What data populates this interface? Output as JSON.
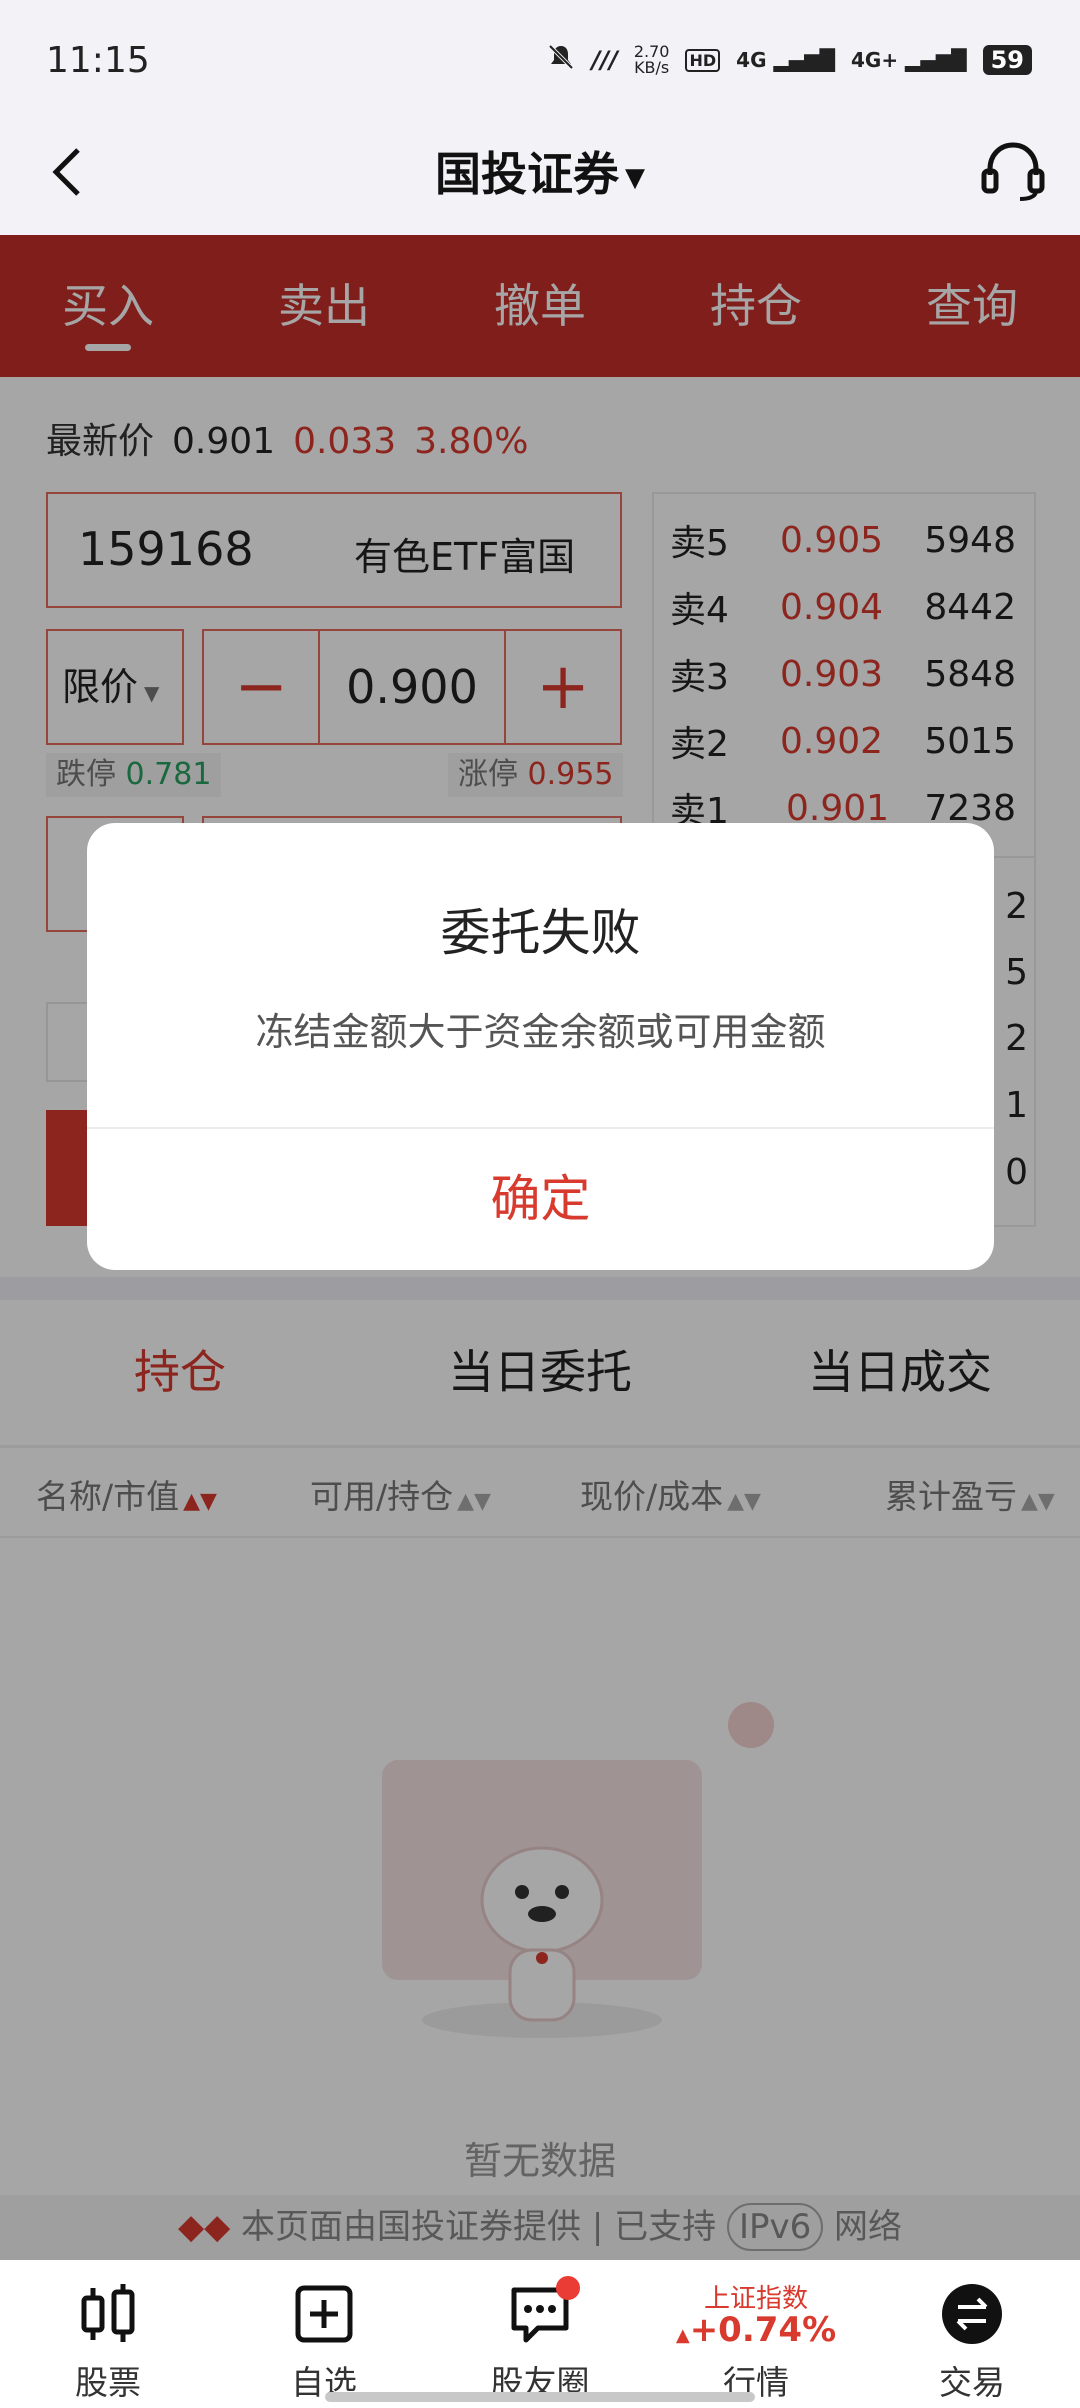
{
  "status_bar": {
    "time": "11:15",
    "net_speed": "2.70",
    "net_unit": "KB/s",
    "signal1": "4G",
    "signal2": "4G+",
    "battery": "59"
  },
  "header": {
    "title": "国投证券",
    "back_icon": "back-arrow-icon",
    "support_icon": "headset-icon"
  },
  "tabs": [
    "买入",
    "卖出",
    "撤单",
    "持仓",
    "查询"
  ],
  "quote": {
    "label": "最新价",
    "price": "0.901",
    "change": "0.033",
    "change_pct": "3.80%"
  },
  "stock": {
    "code": "159168",
    "name": "有色ETF富国"
  },
  "price_type": "限价",
  "stepper": {
    "minus": "−",
    "value": "0.900",
    "plus": "+"
  },
  "limits": {
    "down_label": "跌停",
    "down_value": "0.781",
    "up_label": "涨停",
    "up_value": "0.955"
  },
  "order_book": [
    {
      "label": "卖5",
      "price": "0.905",
      "volume": "5948"
    },
    {
      "label": "卖4",
      "price": "0.904",
      "volume": "8442"
    },
    {
      "label": "卖3",
      "price": "0.903",
      "volume": "5848"
    },
    {
      "label": "卖2",
      "price": "0.902",
      "volume": "5015"
    },
    {
      "label": "卖1",
      "price": "0.901",
      "volume": "7238"
    }
  ],
  "order_book_tail": [
    "2",
    "5",
    "2",
    "1",
    "0"
  ],
  "sub_tabs": [
    "持仓",
    "当日委托",
    "当日成交"
  ],
  "columns": [
    "名称/市值",
    "可用/持仓",
    "现价/成本",
    "累计盈亏"
  ],
  "empty_text": "暂无数据",
  "footer_note": {
    "prefix": "本页面由国投证券提供 | 已支持",
    "badge": "IPv6",
    "suffix": "网络"
  },
  "nav": {
    "items": [
      "股票",
      "自选",
      "股友圈",
      "行情",
      "交易"
    ],
    "index_name": "上证指数",
    "index_change": "+0.74%"
  },
  "dialog": {
    "title": "委托失败",
    "message": "冻结金额大于资金余额或可用金额",
    "ok": "确定"
  },
  "colors": {
    "brand_red": "#c52f2b",
    "accent_red": "#d83a2e",
    "green": "#27a060"
  }
}
